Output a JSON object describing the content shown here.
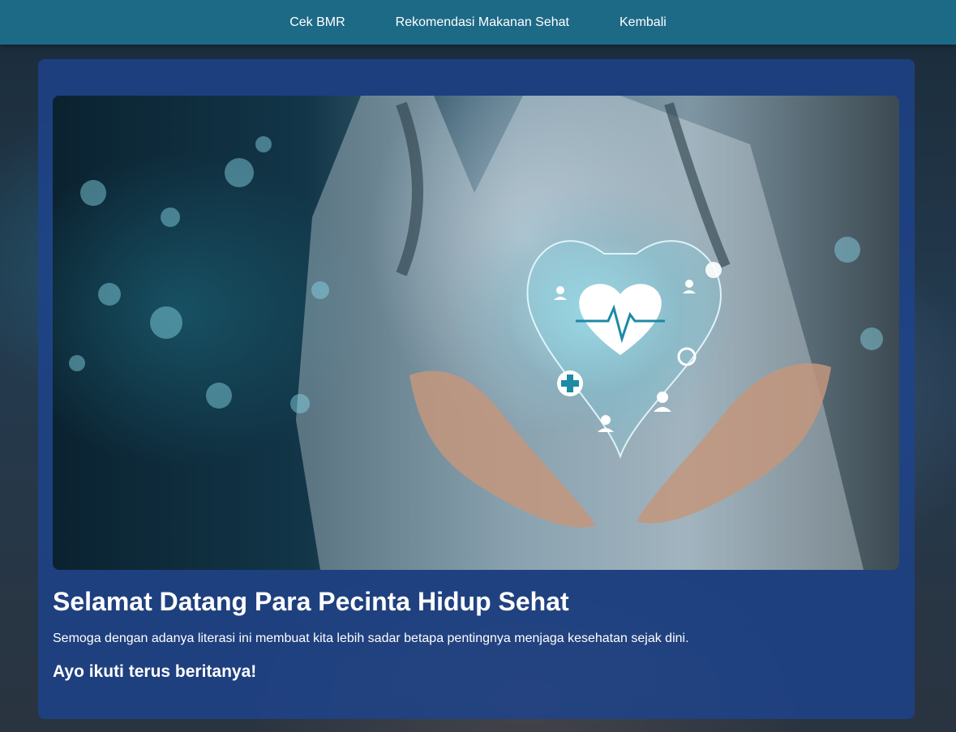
{
  "nav": {
    "items": [
      {
        "label": "Cek BMR"
      },
      {
        "label": "Rekomendasi Makanan Sehat"
      },
      {
        "label": "Kembali"
      }
    ]
  },
  "main": {
    "title": "Selamat Datang Para Pecinta Hidup Sehat",
    "description": "Semoga dengan adanya literasi ini membuat kita lebih sadar betapa pentingnya menjaga kesehatan sejak dini.",
    "cta": "Ayo ikuti terus beritanya!"
  },
  "hero_image": {
    "icons": [
      "heart-icon",
      "heartbeat-line-icon",
      "medical-cross-icon",
      "person-icon",
      "stethoscope-icon"
    ]
  },
  "colors": {
    "navbar": "#1d6a87",
    "card": "#1d438c",
    "text": "#ffffff",
    "glow": "#7fe6f5"
  }
}
